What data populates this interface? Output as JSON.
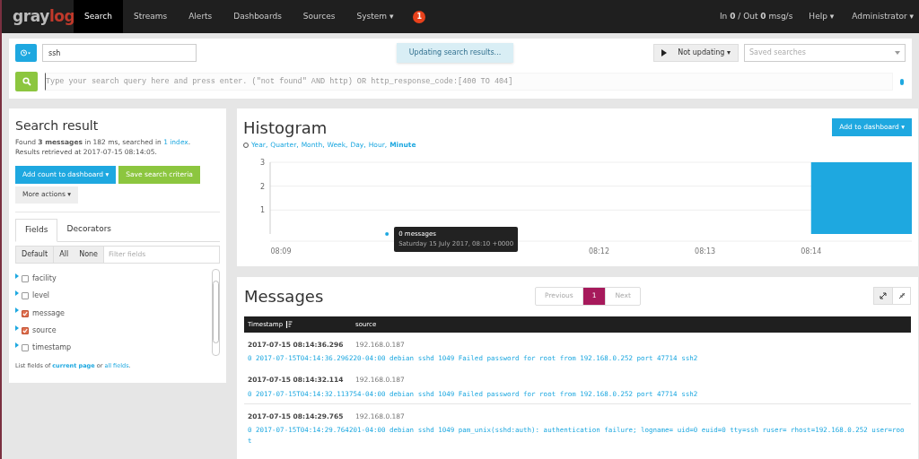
{
  "nav": {
    "logo": {
      "left": "gray",
      "right": "log"
    },
    "items": [
      {
        "label": "Search",
        "selected": true
      },
      {
        "label": "Streams",
        "selected": false
      },
      {
        "label": "Alerts",
        "selected": false
      },
      {
        "label": "Dashboards",
        "selected": false
      },
      {
        "label": "Sources",
        "selected": false
      },
      {
        "label": "System ▾",
        "selected": false
      }
    ],
    "badge": "1",
    "throughput": "In **0** / Out **0** msg/s",
    "right_menus": [
      "Help ▾",
      "Administrator ▾"
    ]
  },
  "search_bar": {
    "range_value": "ssh",
    "notice": "Updating search results...",
    "refresh_button": "Not updating ▾",
    "saved_searches_placeholder": "Saved searches",
    "query_placeholder": "Type your search query here and press enter. (\"not found\" AND http) OR http_response_code:[400 TO 404]"
  },
  "search_result": {
    "title": "Search result",
    "summary": "Found **3 messages** in 182 ms, searched in ",
    "index_link": "1 index",
    "summary_end": ".",
    "retrieved": "Results retrieved at 2017-07-15 08:14:05.",
    "buttons": [
      "Add count to dashboard ▾",
      "Save search criteria",
      "More actions ▾"
    ],
    "tabs": [
      {
        "label": "Fields",
        "selected": true
      },
      {
        "label": "Decorators",
        "selected": false
      }
    ],
    "field_filters": [
      "Default",
      "All",
      "None"
    ],
    "filter_placeholder": "Filter fields",
    "fields": [
      {
        "name": "facility",
        "checked": false
      },
      {
        "name": "level",
        "checked": false
      },
      {
        "name": "message",
        "checked": true
      },
      {
        "name": "source",
        "checked": true
      },
      {
        "name": "timestamp",
        "checked": false
      }
    ],
    "footer": [
      "List fields of ",
      "current page",
      " or ",
      "all fields",
      "."
    ]
  },
  "histogram": {
    "title": "Histogram",
    "resolutions": [
      {
        "label": "Year,",
        "selected": false
      },
      {
        "label": "Quarter,",
        "selected": false
      },
      {
        "label": "Month,",
        "selected": false
      },
      {
        "label": "Week,",
        "selected": false
      },
      {
        "label": "Day,",
        "selected": false
      },
      {
        "label": "Hour,",
        "selected": false
      },
      {
        "label": "Minute",
        "selected": true
      }
    ],
    "add_button": "Add to dashboard ▾",
    "chart_data": {
      "type": "bar",
      "categories": [
        "08:09",
        null,
        null,
        "08:12",
        "08:13",
        "08:14"
      ],
      "series": [
        {
          "color": "#1ea8e0",
          "values": [
            0,
            0,
            0,
            0,
            0,
            3
          ]
        }
      ],
      "ylim": [
        0,
        3
      ],
      "yticks": [
        1,
        2,
        3
      ]
    },
    "tooltip": {
      "title": "0 messages",
      "subtitle": "Saturday 15 July 2017, 08:10 +0000"
    }
  },
  "messages": {
    "title": "Messages",
    "pagination": [
      {
        "label": "Previous",
        "selected": false
      },
      {
        "label": "1",
        "selected": true
      },
      {
        "label": "Next",
        "selected": false
      }
    ],
    "columns": [
      "Timestamp",
      "source"
    ],
    "rows": [
      {
        "timestamp": "2017-07-15 08:14:36.296",
        "source": "192.168.0.187",
        "message": "0 2017-07-15T04:14:36.296220-04:00 debian sshd 1049 Failed password for root from 192.168.0.252 port 47714 ssh2",
        "separated": false
      },
      {
        "timestamp": "2017-07-15 08:14:32.114",
        "source": "192.168.0.187",
        "message": "0 2017-07-15T04:14:32.113754-04:00 debian sshd 1049 Failed password for root from 192.168.0.252 port 47714 ssh2",
        "separated": false
      },
      {
        "timestamp": "2017-07-15 08:14:29.765",
        "source": "192.168.0.187",
        "message": "0 2017-07-15T04:14:29.764201-04:00 debian sshd 1049 pam_unix(sshd:auth): authentication failure; logname= uid=0 euid=0 tty=ssh ruser= rhost=192.168.0.252 user=root",
        "separated": true
      }
    ]
  }
}
